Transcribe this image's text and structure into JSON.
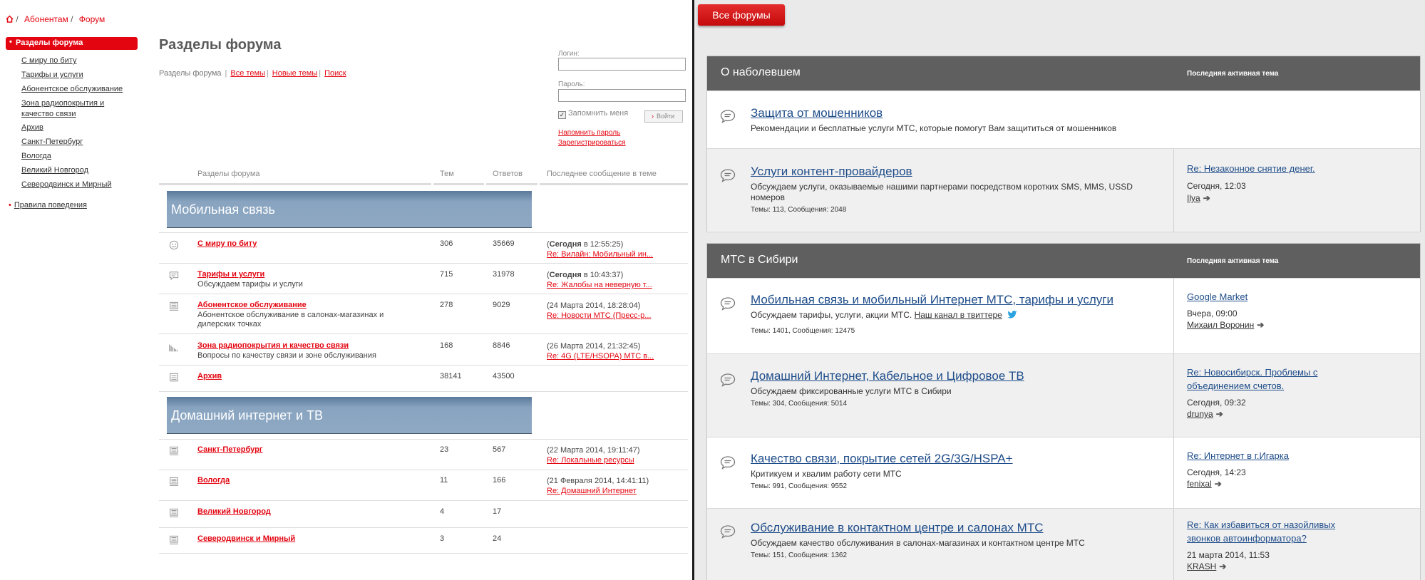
{
  "left": {
    "breadcrumb": [
      "Абонентам",
      "Форум"
    ],
    "sidebar": {
      "active": "Разделы форума",
      "items": [
        "С миру по биту",
        "Тарифы и услуги",
        "Абонентское обслуживание",
        "Зона радиопокрытия и",
        "качество связи",
        "Архив",
        "Санкт-Петербург",
        "Вологда",
        "Великий Новгород",
        "Северодвинск и Мирный"
      ],
      "rules": "Правила поведения"
    },
    "title": "Разделы форума",
    "tabs": {
      "current": "Разделы форума",
      "links": [
        "Все темы",
        "Новые темы",
        "Поиск"
      ]
    },
    "login": {
      "login_label": "Логин:",
      "password_label": "Пароль:",
      "remember": "Запомнить меня",
      "enter": "Войти",
      "remind": "Напомнить пароль",
      "register": "Зарегистрироваться"
    },
    "columns": [
      "Разделы форума",
      "Тем",
      "Ответов",
      "Последнее сообщение в теме"
    ],
    "sections": [
      "Мобильная связь",
      "Домашний интернет и ТВ"
    ],
    "rows": [
      {
        "name": "С миру по биту",
        "desc": "",
        "topics": "306",
        "replies": "35669",
        "last_pre": "(",
        "last_bold": "Сегодня",
        "last_post": " в 12:55:25)",
        "last_link": "Re: Вилайн: Мобильный ин..."
      },
      {
        "name": "Тарифы и услуги",
        "desc": "Обсуждаем тарифы и услуги",
        "topics": "715",
        "replies": "31978",
        "last_pre": "(",
        "last_bold": "Сегодня",
        "last_post": " в 10:43:37)",
        "last_link": "Re: Жалобы на неверную т..."
      },
      {
        "name": "Абонентское обслуживание",
        "desc": "Абонентское обслуживание в салонах-магазинах и дилерских точках",
        "topics": "278",
        "replies": "9029",
        "last_pre": "(24 Марта 2014, 18:28:04)",
        "last_bold": "",
        "last_post": "",
        "last_link": "Re: Новости МТС (Пресс-р..."
      },
      {
        "name": "Зона радиопокрытия и качество связи",
        "desc": "Вопросы по качеству связи и зоне обслуживания",
        "topics": "168",
        "replies": "8846",
        "last_pre": "(26 Марта 2014, 21:32:45)",
        "last_bold": "",
        "last_post": "",
        "last_link": "Re: 4G (LTE/HSOPA) МТС в..."
      },
      {
        "name": "Архив",
        "desc": "",
        "topics": "38141",
        "replies": "43500",
        "last_pre": "",
        "last_bold": "",
        "last_post": "",
        "last_link": ""
      },
      {
        "name": "Санкт-Петербург",
        "desc": "",
        "topics": "23",
        "replies": "567",
        "last_pre": "(22 Марта 2014, 19:11:47)",
        "last_bold": "",
        "last_post": "",
        "last_link": "Re: Локальные ресурсы"
      },
      {
        "name": "Вологда",
        "desc": "",
        "topics": "11",
        "replies": "166",
        "last_pre": "(21 Февраля 2014, 14:41:11)",
        "last_bold": "",
        "last_post": "",
        "last_link": "Re: Домашний Интернет"
      },
      {
        "name": "Великий Новгород",
        "desc": "",
        "topics": "4",
        "replies": "17",
        "last_pre": "",
        "last_bold": "",
        "last_post": "",
        "last_link": ""
      },
      {
        "name": "Северодвинск и Мирный",
        "desc": "",
        "topics": "3",
        "replies": "24",
        "last_pre": "",
        "last_bold": "",
        "last_post": "",
        "last_link": ""
      }
    ]
  },
  "right": {
    "all_forums": "Все форумы",
    "groups": [
      {
        "title": "О наболевшем",
        "last_header": "Последняя активная тема",
        "forums": [
          {
            "title": "Защита от мошенников",
            "desc": "Рекомендации и бесплатные услуги МТС, которые помогут Вам защититься от мошенников",
            "desc2": "",
            "link": "",
            "stats": "",
            "last_title": "",
            "last_title2": "",
            "last_time": "",
            "last_user": ""
          },
          {
            "title": "Услуги контент-провайдеров",
            "desc": "Обсуждаем услуги, оказываемые нашими партнерами посредством коротких SMS, MMS, USSD",
            "desc2": "номеров",
            "link": "",
            "stats": "Темы: 113,   Сообщения: 2048",
            "last_title": "Re: Незаконное снятие денег.",
            "last_title2": "",
            "last_time": "Сегодня, 12:03",
            "last_user": "Ilya"
          }
        ]
      },
      {
        "title": "МТС в Сибири",
        "last_header": "Последняя активная тема",
        "forums": [
          {
            "title": "Мобильная связь и мобильный Интернет МТС, тарифы и услуги",
            "desc": "Обсуждаем тарифы, услуги, акции МТС. ",
            "desc2": "",
            "link": "Наш канал в твиттере",
            "stats": "Темы: 1401,   Сообщения: 12475",
            "last_title": "Google Market",
            "last_title2": "",
            "last_time": "Вчера, 09:00",
            "last_user": "Михаил Воронин"
          },
          {
            "title": "Домашний Интернет, Кабельное и Цифровое ТВ",
            "desc": "Обсуждаем фиксированные услуги МТС в Сибири",
            "desc2": "",
            "link": "",
            "stats": "Темы: 304,   Сообщения: 5014",
            "last_title": "Re: Новосибирск. Проблемы с",
            "last_title2": "объединением счетов.",
            "last_time": "Сегодня, 09:32",
            "last_user": "drunya"
          },
          {
            "title": "Качество связи, покрытие сетей 2G/3G/HSPA+",
            "desc": "Критикуем и хвалим работу сети МТС",
            "desc2": "",
            "link": "",
            "stats": "Темы: 991,   Сообщения: 9552",
            "last_title": "Re: Интернет в г.Игарка",
            "last_title2": "",
            "last_time": "Сегодня, 14:23",
            "last_user": "fenixal"
          },
          {
            "title": "Обслуживание в контактном центре и салонах МТС",
            "desc": "Обсуждаем качество обслуживания в салонах-магазинах и контактном центре МТС",
            "desc2": "",
            "link": "",
            "stats": "Темы: 151,   Сообщения: 1362",
            "last_title": "Re: Как избавиться от назойливых",
            "last_title2": "звонков автоинформатора?",
            "last_time": "21 марта 2014, 11:53",
            "last_user": "KRASH"
          }
        ]
      }
    ]
  }
}
